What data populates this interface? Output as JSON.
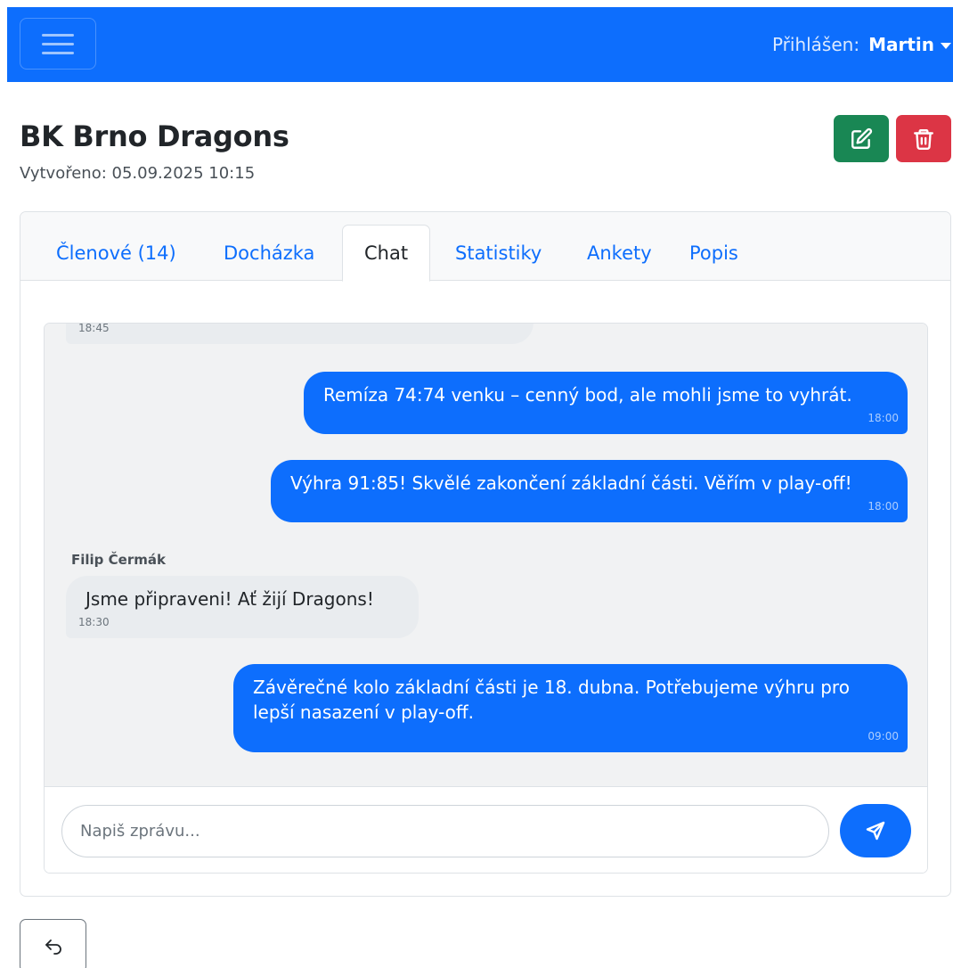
{
  "navbar": {
    "logged_in_label": "Přihlášen:",
    "user_name": "Martin"
  },
  "team": {
    "title": "BK Brno Dragons",
    "created": "Vytvořeno: 05.09.2025 10:15"
  },
  "tabs": [
    {
      "label": "Členové (14)"
    },
    {
      "label": "Docházka"
    },
    {
      "label": "Chat",
      "active": true
    },
    {
      "label": "Statistiky"
    },
    {
      "label": "Ankety"
    },
    {
      "label": "Popis"
    }
  ],
  "chat": {
    "messages": [
      {
        "side": "other",
        "sender": "",
        "text": "",
        "time": "18:45"
      },
      {
        "side": "mine",
        "text": "Remíza 74:74 venku – cenný bod, ale mohli jsme to vyhrát.",
        "time": "18:00"
      },
      {
        "side": "mine",
        "text": "Výhra 91:85! Skvělé zakončení základní části. Věřím v play-off!",
        "time": "18:00"
      },
      {
        "side": "other",
        "sender": "Filip Čermák",
        "text": "Jsme připraveni! Ať žijí Dragons!",
        "time": "18:30"
      },
      {
        "side": "mine",
        "text": "Závěrečné kolo základní části je 18. dubna. Potřebujeme výhru pro lepší nasazení v play-off.",
        "time": "09:00"
      }
    ],
    "input_placeholder": "Napiš zprávu..."
  },
  "icons": {
    "edit": "pencil-square-icon",
    "delete": "trash-icon",
    "send": "send-icon",
    "back": "arrow-return-left-icon",
    "menu": "hamburger-icon"
  },
  "colors": {
    "primary": "#0d6efd",
    "success": "#198754",
    "danger": "#dc3545"
  }
}
